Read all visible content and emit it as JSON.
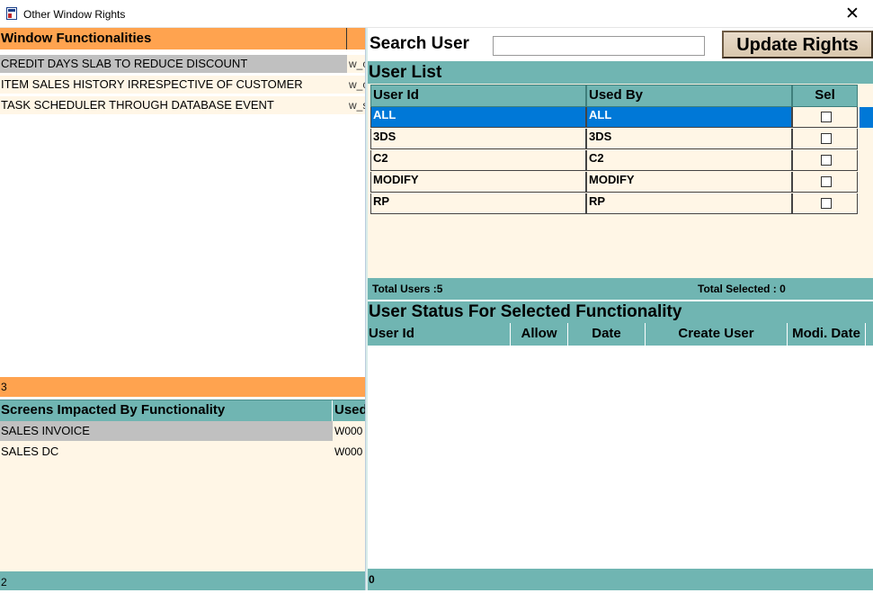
{
  "window": {
    "title": "Other Window Rights",
    "close_symbol": "✕"
  },
  "window_functionalities": {
    "header": "Window Functionalities",
    "rows": [
      {
        "name": "CREDIT DAYS SLAB TO REDUCE DISCOUNT",
        "code": "w_c",
        "selected": true
      },
      {
        "name": "ITEM SALES HISTORY IRRESPECTIVE OF CUSTOMER",
        "code": "w_c",
        "selected": false
      },
      {
        "name": "TASK SCHEDULER THROUGH DATABASE EVENT",
        "code": "w_s",
        "selected": false
      }
    ],
    "count": "3"
  },
  "screens_impacted": {
    "header": "Screens Impacted By Functionality",
    "col2_header": "Used",
    "rows": [
      {
        "name": "SALES INVOICE",
        "code": "W000",
        "selected": true
      },
      {
        "name": "SALES DC",
        "code": "W000",
        "selected": false
      }
    ],
    "count": "2"
  },
  "search": {
    "label": "Search User",
    "value": ""
  },
  "update_button": {
    "label": "Update Rights"
  },
  "user_list": {
    "title": "User List",
    "columns": [
      "User Id",
      "Used By",
      "Sel"
    ],
    "rows": [
      {
        "user_id": "ALL",
        "used_by": "ALL",
        "sel": false,
        "selected": true
      },
      {
        "user_id": "3DS",
        "used_by": "3DS",
        "sel": false,
        "selected": false
      },
      {
        "user_id": "C2",
        "used_by": "C2",
        "sel": false,
        "selected": false
      },
      {
        "user_id": "MODIFY",
        "used_by": "MODIFY",
        "sel": false,
        "selected": false
      },
      {
        "user_id": "RP",
        "used_by": "RP",
        "sel": false,
        "selected": false
      }
    ],
    "total_users": "Total Users :5",
    "total_selected": "Total  Selected :  0"
  },
  "user_status": {
    "title": "User Status For Selected Functionality",
    "columns": [
      "User Id",
      "Allow",
      "Date",
      "Create User",
      "Modi. Date"
    ],
    "count": "0"
  },
  "colors": {
    "orange_header": "#ffa34f",
    "teal_header": "#70b5b2",
    "row_background": "#fff6e6",
    "selected_blue": "#0078d7",
    "selected_gray": "#c0c0c0"
  }
}
